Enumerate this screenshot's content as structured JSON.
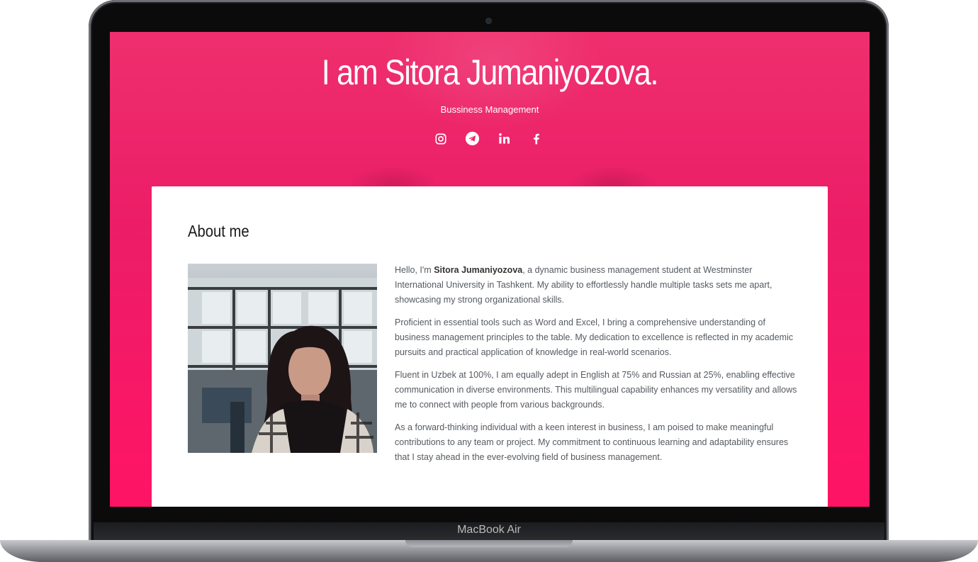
{
  "hero": {
    "title": "I am Sitora Jumaniyozova.",
    "subtitle": "Bussiness Management",
    "socials": [
      "instagram-icon",
      "telegram-icon",
      "linkedin-icon",
      "facebook-icon"
    ]
  },
  "about": {
    "heading": "About me",
    "intro_prefix": "Hello, I'm ",
    "name": "Sitora Jumaniyozova",
    "intro_suffix": ", a dynamic business management student at Westminster International University in Tashkent. My ability to effortlessly handle multiple tasks sets me apart, showcasing my strong organizational skills.",
    "p2": "Proficient in essential tools such as Word and Excel, I bring a comprehensive understanding of business management principles to the table. My dedication to excellence is reflected in my academic pursuits and practical application of knowledge in real-world scenarios.",
    "p3": "Fluent in Uzbek at 100%, I am equally adept in English at 75% and Russian at 25%, enabling effective communication in diverse environments. This multilingual capability enhances my versatility and allows me to connect with people from various backgrounds.",
    "p4": "As a forward-thinking individual with a keen interest in business, I am poised to make meaningful contributions to any team or project. My commitment to continuous learning and adaptability ensures that I stay ahead in the ever-evolving field of business management."
  },
  "device": {
    "label": "MacBook Air"
  },
  "colors": {
    "accent": "#ff1465",
    "card": "#ffffff",
    "text": "#555a60"
  }
}
